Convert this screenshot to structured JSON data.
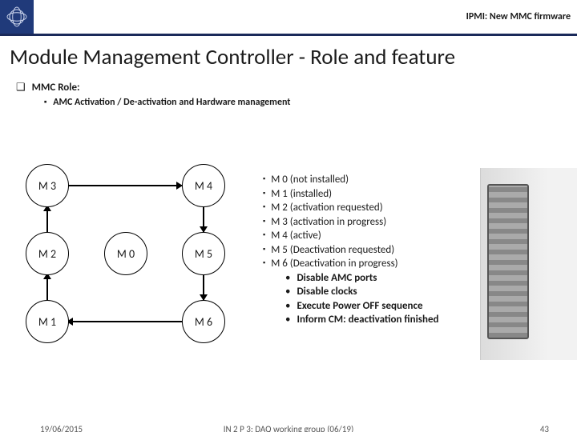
{
  "header": {
    "topic": "IPMI: New MMC firmware"
  },
  "title": "Module Management Controller - Role and feature",
  "role": {
    "heading": "MMC Role:",
    "sub": "AMC Activation / De-activation and Hardware management"
  },
  "states": {
    "M0": "M 0",
    "M1": "M 1",
    "M2": "M 2",
    "M3": "M 3",
    "M4": "M 4",
    "M5": "M 5",
    "M6": "M 6"
  },
  "legend": {
    "items": [
      "M 0 (not installed)",
      "M 1 (installed)",
      "M 2 (activation requested)",
      "M 3 (activation in progress)",
      "M 4 (active)",
      "M 5 (Deactivation requested)",
      "M 6 (Deactivation in progress)"
    ],
    "sub_items": [
      "Disable AMC ports",
      "Disable clocks",
      "Execute Power OFF sequence",
      "Inform CM: deactivation finished"
    ]
  },
  "footer": {
    "date": "19/06/2015",
    "caption": "IN 2 P 3: DAQ working group (06/19)",
    "page": "43"
  }
}
